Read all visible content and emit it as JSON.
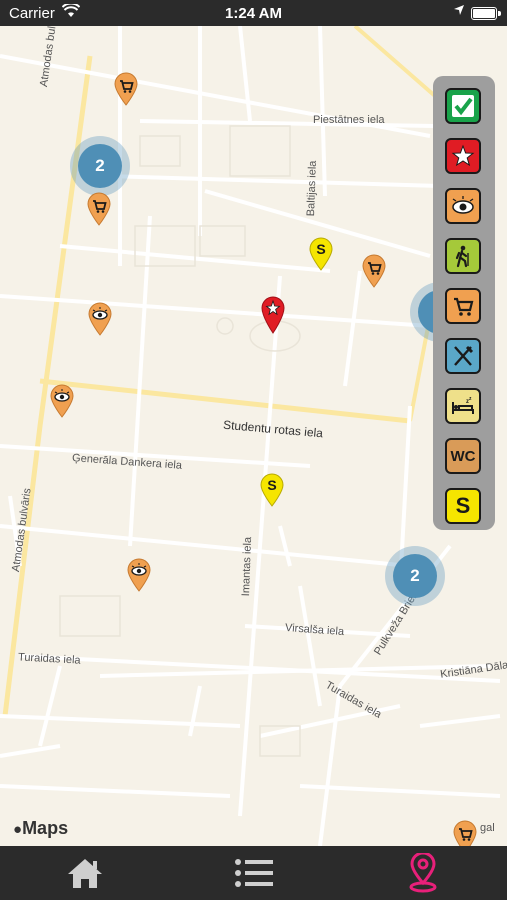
{
  "status_bar": {
    "carrier": "Carrier",
    "time": "1:24 AM"
  },
  "map": {
    "streets": {
      "atmodas_upper": "Atmodas bulvāris",
      "atmodas_lower": "Atmodas bulvāris",
      "piestatnes": "Piestātnes iela",
      "baltijas": "Baltijas iela",
      "studentu": "Studentu rotas iela",
      "generala": "Ģenerāla Dankera iela",
      "imantas": "Imantas iela",
      "virsalsa": "Virsalša iela",
      "puteza": "Pulkveža Brieža iela",
      "turaidas_left": "Turaidas iela",
      "turaidas_right": "Turaidas iela",
      "kristiana": "Kristiāna Dāla",
      "edge": "gal"
    },
    "clusters": [
      {
        "count": "2"
      },
      {
        "count": "2"
      }
    ],
    "attribution": "Maps",
    "colors": {
      "background": "#f6f2e8",
      "road": "#ffffff",
      "major_road": "#fbe8a6",
      "pin_orange": "#f0a050",
      "pin_yellow": "#f5e500",
      "pin_red": "#e01c24",
      "cluster": "#4f8fb6"
    }
  },
  "filters": [
    {
      "name": "all",
      "icon": "checkmark-icon",
      "color": "#19a34a"
    },
    {
      "name": "attractions",
      "icon": "star-icon",
      "color": "#e01c24"
    },
    {
      "name": "sights",
      "icon": "eye-icon",
      "color": "#f0a050"
    },
    {
      "name": "hiking",
      "icon": "hiker-icon",
      "color": "#a5c93a"
    },
    {
      "name": "shopping",
      "icon": "cart-icon",
      "color": "#f0a050"
    },
    {
      "name": "food",
      "icon": "fork-knife-icon",
      "color": "#5aa7c8"
    },
    {
      "name": "accommodation",
      "icon": "bed-icon",
      "color": "#efe08a"
    },
    {
      "name": "toilets",
      "icon": "wc-icon",
      "color": "#d99b58",
      "label": "WC"
    },
    {
      "name": "parking",
      "icon": "s-icon",
      "color": "#f5e500",
      "label": "S"
    }
  ],
  "tabbar": {
    "tabs": [
      {
        "name": "home",
        "icon": "home-icon"
      },
      {
        "name": "list",
        "icon": "list-icon"
      },
      {
        "name": "map",
        "icon": "map-pin-icon",
        "active_color": "#e8207a"
      }
    ]
  }
}
